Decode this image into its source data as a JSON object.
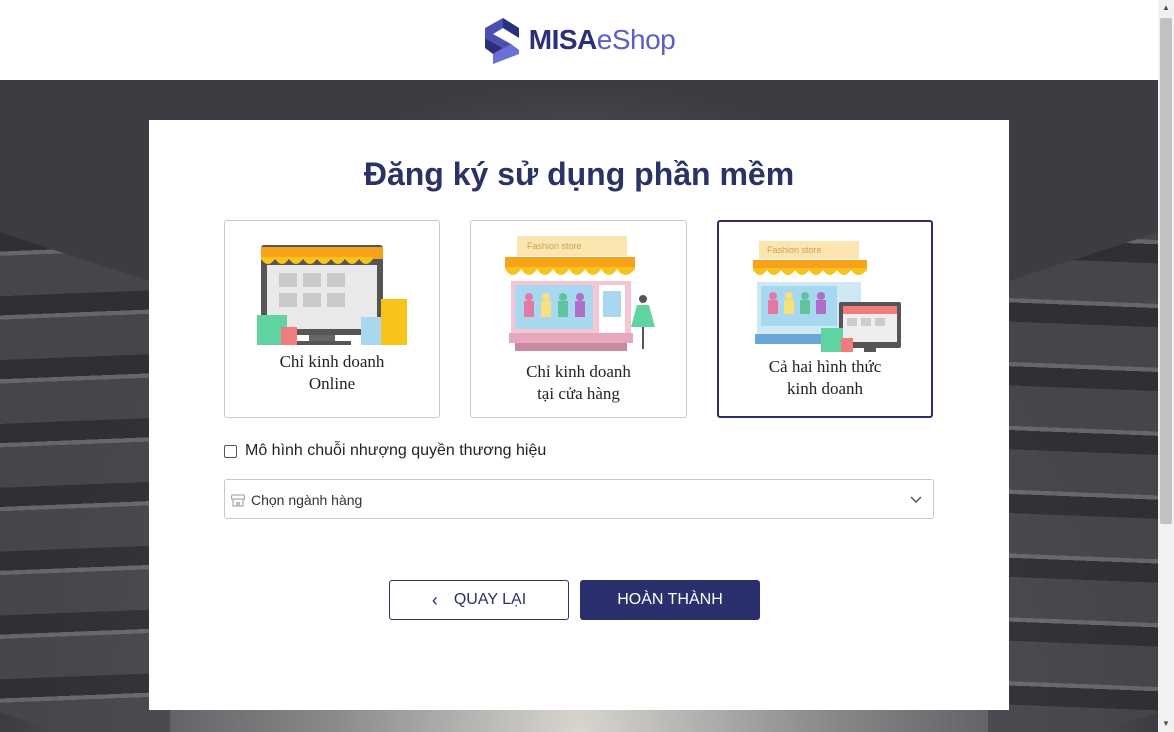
{
  "header": {
    "logo_bold": "MISA",
    "logo_light": "eShop"
  },
  "card": {
    "title": "Đăng ký sử dụng phần mềm",
    "options": [
      {
        "line1": "Chỉ kinh doanh",
        "line2": "Online",
        "selected": false
      },
      {
        "line1": "Chỉ kinh doanh",
        "line2": "tại cửa hàng",
        "selected": false,
        "sign_text": "Fashion store"
      },
      {
        "line1": "Cả hai hình thức",
        "line2": "kinh doanh",
        "selected": true,
        "sign_text": "Fashion store"
      }
    ],
    "franchise_checkbox": {
      "label": "Mô hình chuỗi nhượng quyền thương hiệu",
      "checked": false
    },
    "industry_select": {
      "placeholder": "Chọn ngành hàng"
    },
    "back_button": "QUAY LẠI",
    "finish_button": "HOÀN THÀNH"
  },
  "colors": {
    "brand": "#2b2f6b",
    "button_primary": "#2a2f6e",
    "awning_orange": "#f7a21a"
  }
}
